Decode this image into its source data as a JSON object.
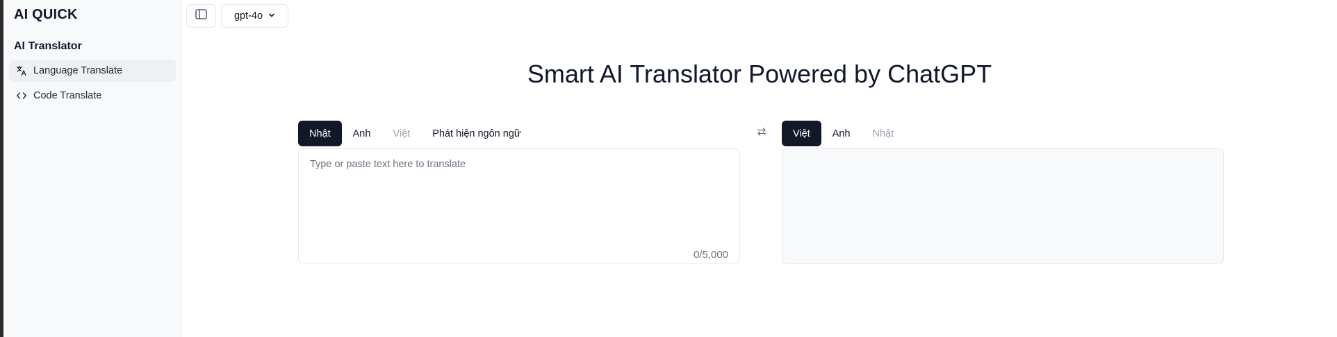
{
  "sidebar": {
    "brand": "AI QUICK",
    "section_title": "AI Translator",
    "items": [
      {
        "label": "Language Translate",
        "icon": "translate-icon",
        "active": true
      },
      {
        "label": "Code Translate",
        "icon": "code-icon",
        "active": false
      }
    ]
  },
  "toolbar": {
    "panel_toggle_icon": "sidebar-toggle-icon",
    "model": "gpt-4o",
    "model_icon": "chevron-down-icon"
  },
  "main": {
    "title": "Smart AI Translator Powered by ChatGPT",
    "source_tabs": [
      {
        "label": "Nhật",
        "state": "selected"
      },
      {
        "label": "Anh",
        "state": "normal"
      },
      {
        "label": "Việt",
        "state": "disabled"
      },
      {
        "label": "Phát hiện ngôn ngữ",
        "state": "normal"
      }
    ],
    "swap_icon": "swap-icon",
    "target_tabs": [
      {
        "label": "Việt",
        "state": "selected"
      },
      {
        "label": "Anh",
        "state": "normal"
      },
      {
        "label": "Nhật",
        "state": "disabled"
      }
    ],
    "source": {
      "placeholder": "Type or paste text here to translate",
      "value": "",
      "counter": "0/5,000"
    },
    "target": {
      "value": ""
    }
  },
  "colors": {
    "accent": "#111827",
    "sidebar_bg": "#f8f9fb",
    "border": "#e5e7eb",
    "muted_text": "#9ca3af"
  }
}
